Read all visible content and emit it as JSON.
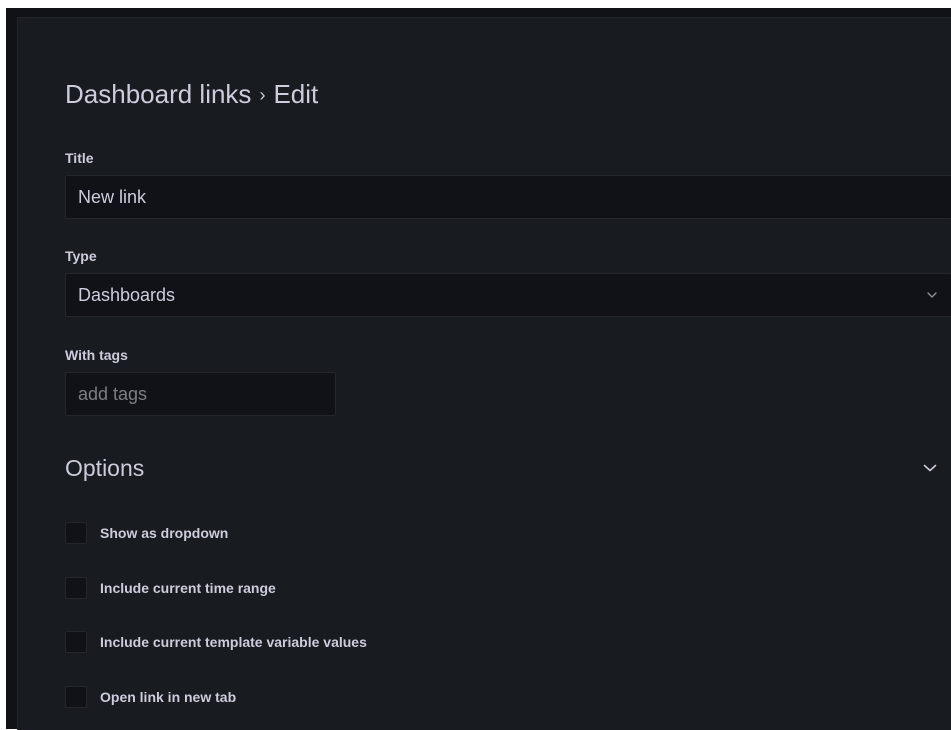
{
  "header": {
    "breadcrumb_parent": "Dashboard links",
    "breadcrumb_separator": "›",
    "breadcrumb_current": "Edit"
  },
  "form": {
    "title": {
      "label": "Title",
      "value": "New link"
    },
    "type": {
      "label": "Type",
      "value": "Dashboards",
      "icon": "chevron-down-icon"
    },
    "tags": {
      "label": "With tags",
      "placeholder": "add tags",
      "value": ""
    }
  },
  "options": {
    "title": "Options",
    "icon": "chevron-down-icon",
    "checkboxes": [
      {
        "label": "Show as dropdown",
        "checked": false
      },
      {
        "label": "Include current time range",
        "checked": false
      },
      {
        "label": "Include current template variable values",
        "checked": false
      },
      {
        "label": "Open link in new tab",
        "checked": false
      }
    ]
  },
  "colors": {
    "background": "#181b1f",
    "input_background": "#111217",
    "text": "#ccccdc"
  }
}
